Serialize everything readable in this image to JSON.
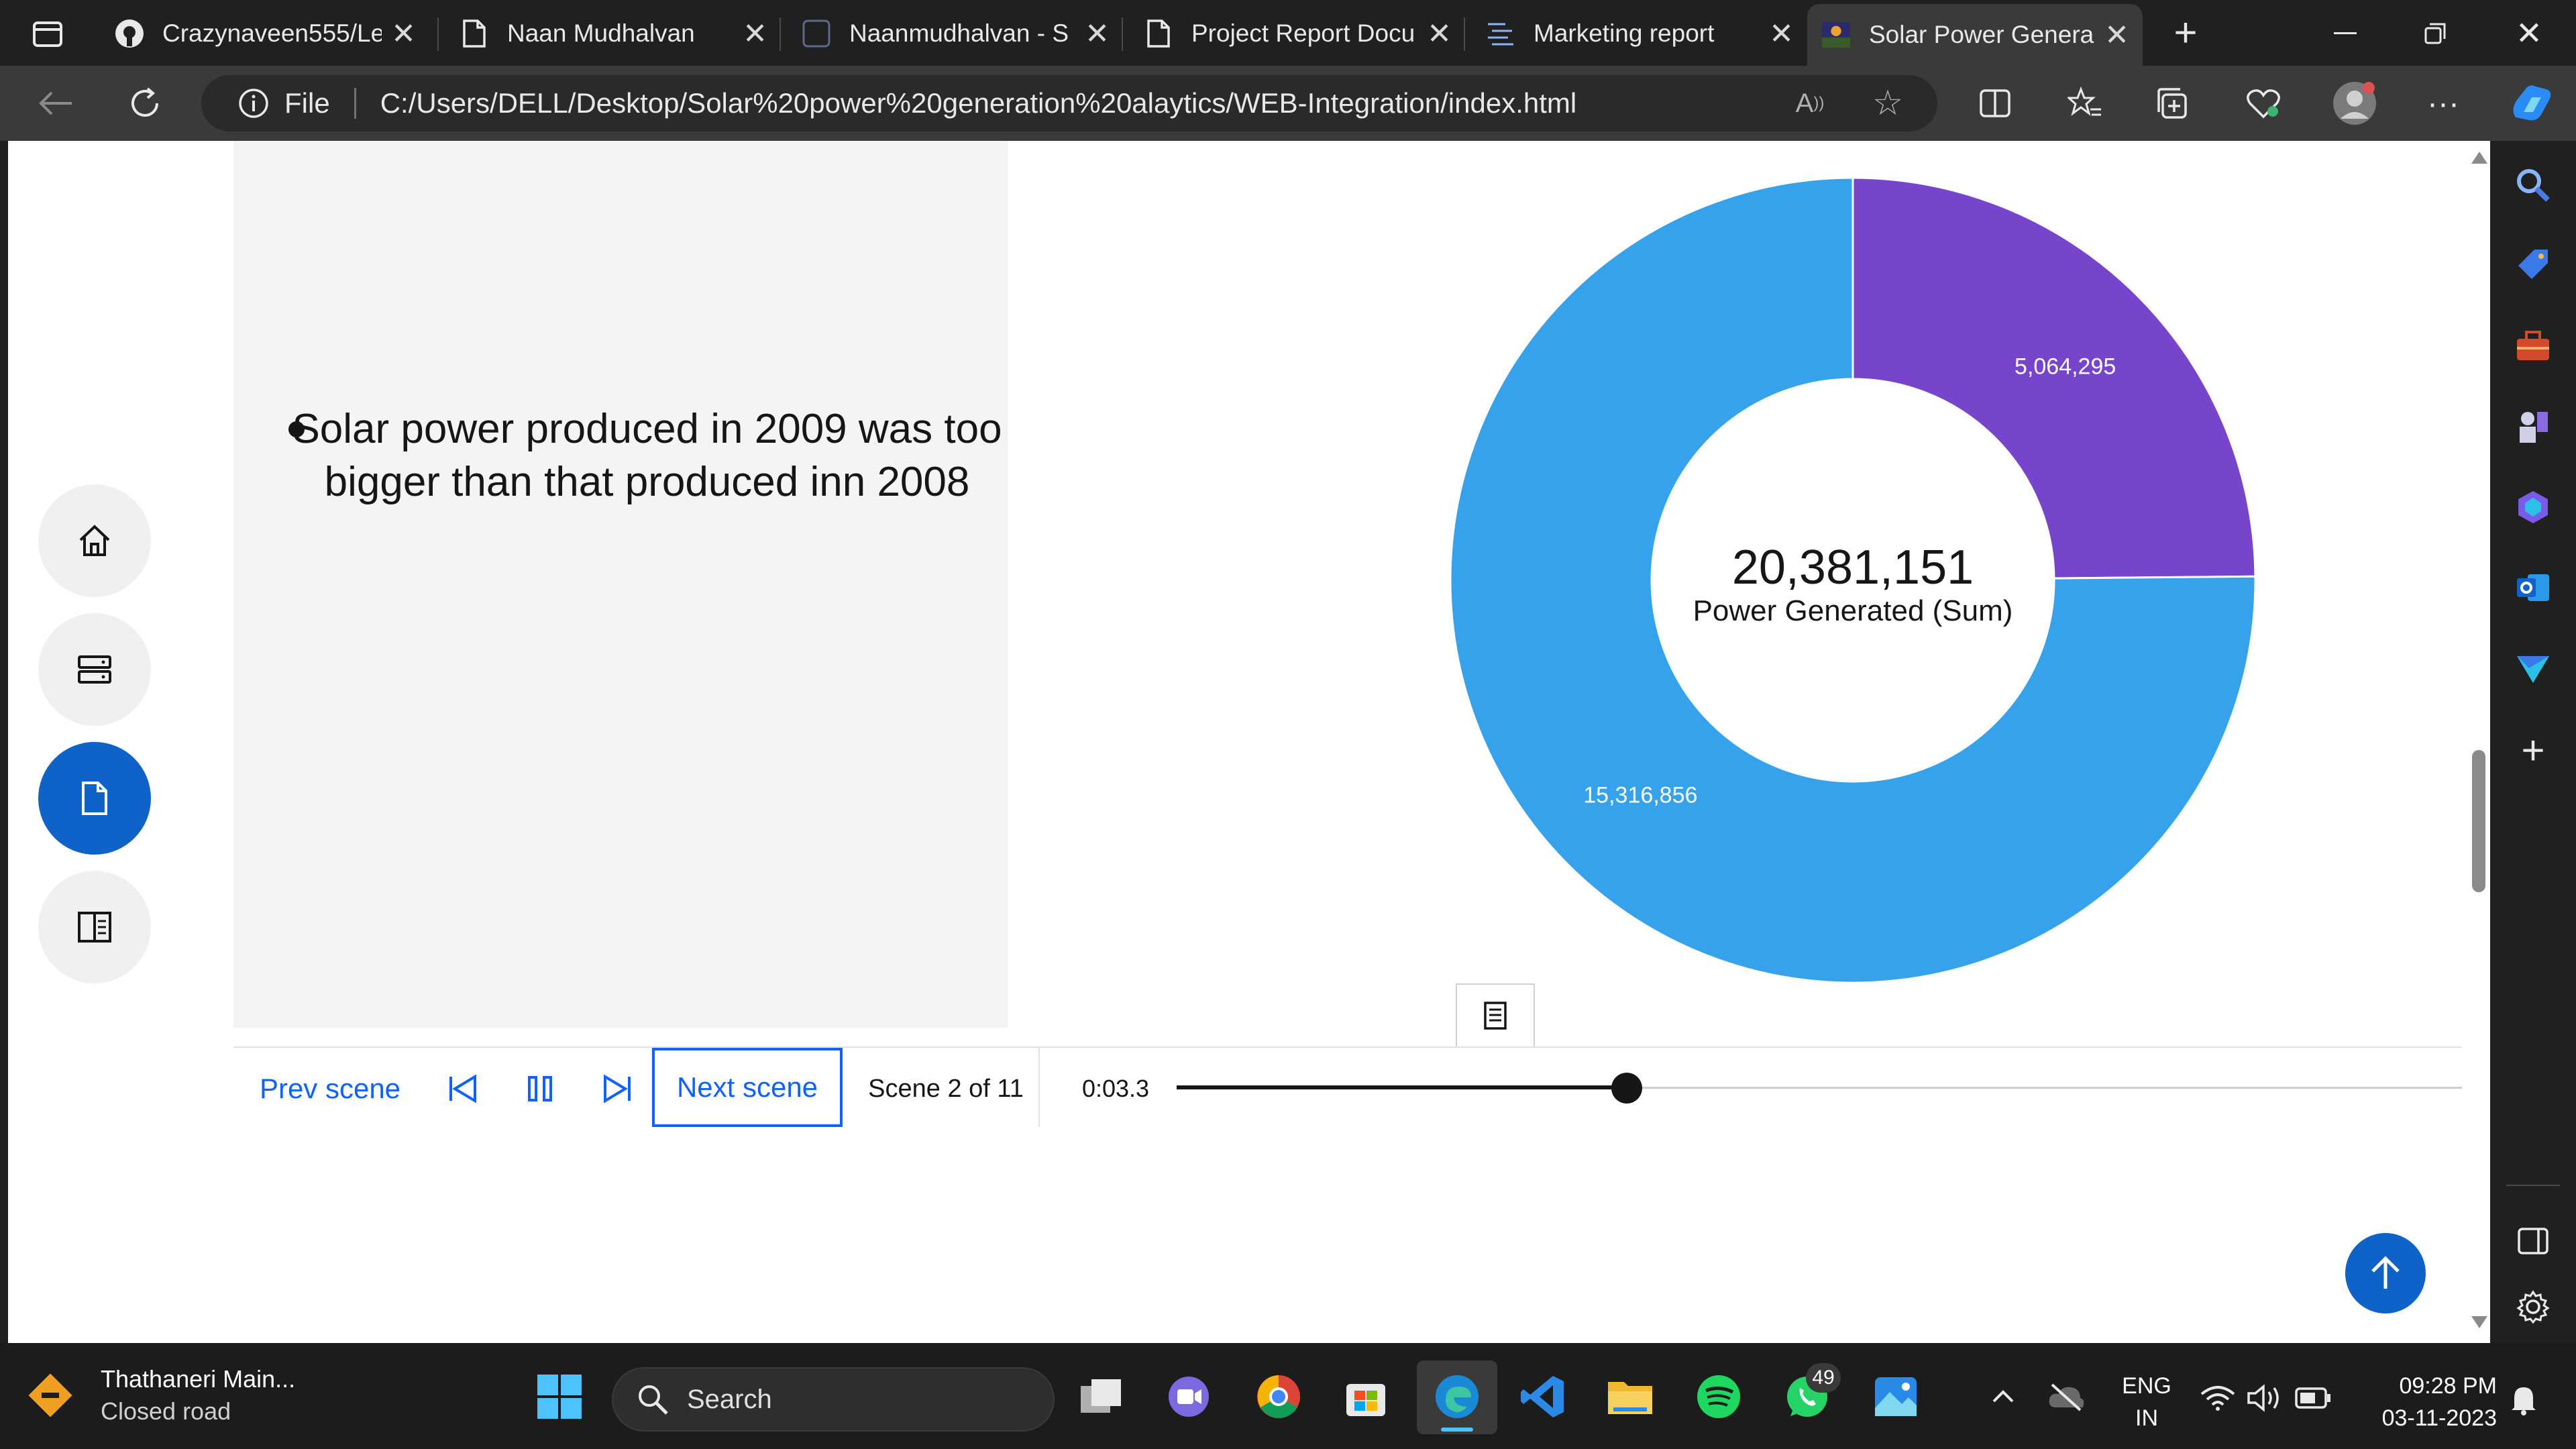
{
  "browser": {
    "tabs": [
      {
        "label": "Crazynaveen555/Le",
        "icon": "github-icon"
      },
      {
        "label": "Naan Mudhalvan",
        "icon": "page-icon"
      },
      {
        "label": "Naanmudhalvan - S",
        "icon": "app-icon"
      },
      {
        "label": "Project Report Docu",
        "icon": "page-icon"
      },
      {
        "label": "Marketing report",
        "icon": "list-icon"
      },
      {
        "label": "Solar Power Genera",
        "icon": "solar-favicon"
      }
    ],
    "active_tab_index": 5,
    "address": {
      "scheme": "File",
      "url": "C:/Users/DELL/Desktop/Solar%20power%20generation%20alaytics/WEB-Integration/index.html"
    }
  },
  "story": {
    "bullet": "Solar power produced in 2009 was too bigger than that produced inn 2008",
    "controls": {
      "prev_label": "Prev scene",
      "next_label": "Next scene",
      "scene_label": "Scene 2 of 11",
      "time": "0:03.3",
      "progress": 0.35
    }
  },
  "chart_data": {
    "type": "pie",
    "donut": true,
    "center_value": "20,381,151",
    "center_label": "Power Generated (Sum)",
    "slices": [
      {
        "value": 5064295,
        "label": "5,064,295",
        "color": "#7744cc"
      },
      {
        "value": 15316856,
        "label": "15,316,856",
        "color": "#36a2eb"
      }
    ]
  },
  "taskbar": {
    "weather_title": "Thathaneri Main...",
    "weather_sub": "Closed road",
    "search_placeholder": "Search",
    "whatsapp_badge": "49",
    "lang_top": "ENG",
    "lang_bottom": "IN",
    "clock_time": "09:28 PM",
    "clock_date": "03-11-2023"
  },
  "colors": {
    "accent": "#0f62fe",
    "nav_active": "#0f62c7",
    "chart_purple": "#7744cc",
    "chart_blue": "#36a2eb"
  }
}
